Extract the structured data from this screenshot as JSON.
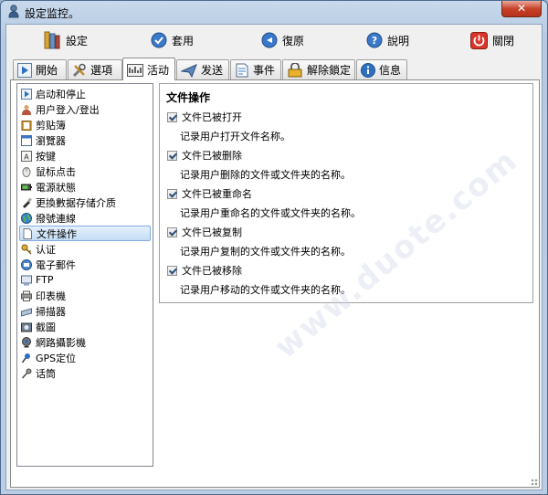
{
  "window": {
    "title": "設定监控。",
    "close_label": "✕"
  },
  "toolbar": {
    "settings_label": "設定",
    "apply_label": "套用",
    "restore_label": "復原",
    "help_label": "說明",
    "close_label": "關閉"
  },
  "tabs": [
    {
      "label": "開始"
    },
    {
      "label": "選項"
    },
    {
      "label": "活动"
    },
    {
      "label": "发送"
    },
    {
      "label": "事件"
    },
    {
      "label": "解除鎖定"
    },
    {
      "label": "信息"
    }
  ],
  "tree": {
    "items": [
      {
        "label": "启动和停止",
        "icon": "play-icon"
      },
      {
        "label": "用户登入/登出",
        "icon": "user-icon"
      },
      {
        "label": "剪贴簿",
        "icon": "clipboard-icon"
      },
      {
        "label": "瀏覽器",
        "icon": "browser-icon"
      },
      {
        "label": "按键",
        "icon": "keyboard-icon"
      },
      {
        "label": "鼠标点击",
        "icon": "mouse-icon"
      },
      {
        "label": "電源狀態",
        "icon": "battery-icon"
      },
      {
        "label": "更換數据存储介质",
        "icon": "usb-icon"
      },
      {
        "label": "撥號連線",
        "icon": "globe-icon"
      },
      {
        "label": "文件操作",
        "icon": "file-icon"
      },
      {
        "label": "认证",
        "icon": "key-icon"
      },
      {
        "label": "電子郵件",
        "icon": "email-icon"
      },
      {
        "label": "FTP",
        "icon": "ftp-icon"
      },
      {
        "label": "印表機",
        "icon": "printer-icon"
      },
      {
        "label": "掃描器",
        "icon": "scanner-icon"
      },
      {
        "label": "截圖",
        "icon": "screenshot-icon"
      },
      {
        "label": "網路攝影機",
        "icon": "webcam-icon"
      },
      {
        "label": "GPS定位",
        "icon": "pin-icon"
      },
      {
        "label": "话筒",
        "icon": "microphone-icon"
      }
    ],
    "selected": "文件操作"
  },
  "file_ops": {
    "title": "文件操作",
    "options": [
      {
        "label": "文件已被打开",
        "description": "记录用户打开文件名称。",
        "checked": true
      },
      {
        "label": "文件已被删除",
        "description": "记录用户删除的文件或文件夹的名称。",
        "checked": true
      },
      {
        "label": "文件已被重命名",
        "description": "记录用户重命名的文件或文件夹的名称。",
        "checked": true
      },
      {
        "label": "文件已被复制",
        "description": "记录用户复制的文件或文件夹的名称。",
        "checked": true
      },
      {
        "label": "文件已被移除",
        "description": "记录用户移动的文件或文件夹的名称。",
        "checked": true
      }
    ]
  },
  "watermark": "www.duote.com",
  "colors": {
    "accent": "#3a78c8",
    "close_red": "#c7432a",
    "selection": "#c4ddf6"
  }
}
